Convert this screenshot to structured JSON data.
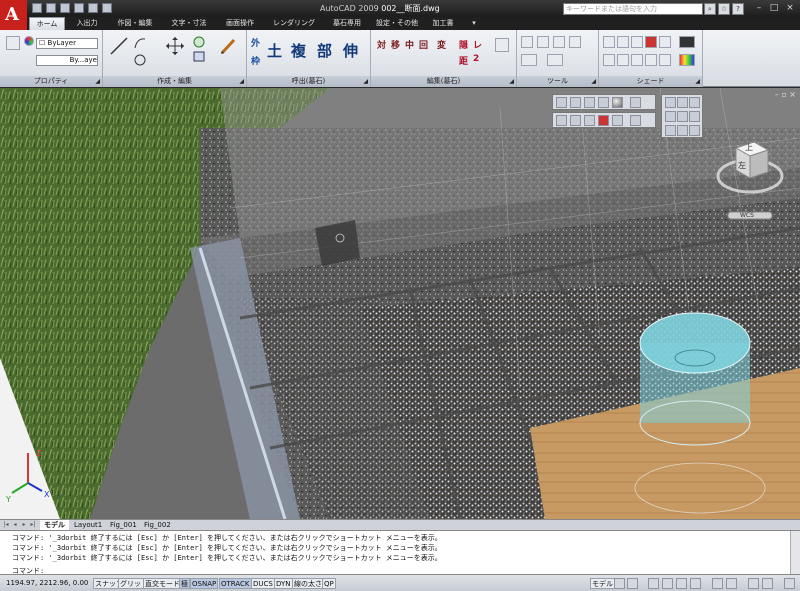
{
  "title": {
    "app": "AutoCAD 2009",
    "file": "002__断面.dwg"
  },
  "search": {
    "placeholder": "キーワードまたは語句を入力"
  },
  "ribbon_tabs": [
    "ホーム",
    "入出力",
    "作図・編集",
    "文字・寸法",
    "画面操作",
    "レンダリング",
    "墓石専用",
    "設定・その他",
    "加工書"
  ],
  "ribbon": {
    "panels": [
      "プロパティ",
      "作成・編集",
      "呼出(墓石)",
      "編集(墓石)",
      "ツール",
      "シェード"
    ],
    "layer_combo": "ByLayer",
    "linetype_combo": "By...aye",
    "kanji_call": [
      "外",
      "枠",
      "土",
      "複",
      "部",
      "伸"
    ],
    "kanji_edit": [
      "対",
      "移",
      "中",
      "回",
      "変",
      "隠",
      "レ",
      "距",
      "2"
    ]
  },
  "colors": {
    "accent": "#c8201a",
    "active_tab": "#dbe1ea",
    "glass": "#7fd3de",
    "wood": "#c89a63",
    "grass": "#4b6a2e"
  },
  "viewcube": {
    "top_label": "上",
    "front_label": "左",
    "wcs_label": "WCS"
  },
  "layout_tabs": [
    "モデル",
    "Layout1",
    "Fig_001",
    "Fig_002"
  ],
  "command_history": [
    "コマンド: '_3dorbit 終了するには [Esc] か [Enter] を押してください、または右クリックでショートカット メニューを表示。",
    "コマンド: '_3dorbit 終了するには [Esc] か [Enter] を押してください、または右クリックでショートカット メニューを表示。",
    "コマンド: '_3dorbit 終了するには [Esc] か [Enter] を押してください、または右クリックでショートカット メニューを表示。"
  ],
  "command_prompt": "コマンド:",
  "status": {
    "coords": "1194.97, 2212.96, 0.00",
    "toggles": [
      "スナップ",
      "グリッド",
      "直交モード",
      "極",
      "OSNAP",
      "OTRACK",
      "DUCS",
      "DYN",
      "線の太さ",
      "QP"
    ],
    "model_label": "モデル"
  }
}
